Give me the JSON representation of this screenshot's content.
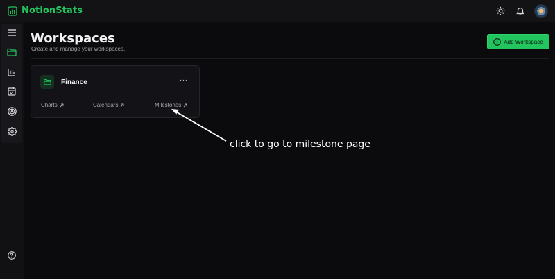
{
  "app": {
    "name": "NotionStats",
    "accent": "#22c55e"
  },
  "topbar": {
    "icons": [
      "theme-toggle-icon",
      "bell-icon"
    ]
  },
  "sidebar": {
    "items": [
      {
        "icon": "menu-icon"
      },
      {
        "icon": "folder-icon",
        "active": true
      },
      {
        "icon": "bar-chart-icon"
      },
      {
        "icon": "calendar-icon"
      },
      {
        "icon": "target-icon"
      },
      {
        "icon": "gear-icon"
      }
    ],
    "help_icon": "help-icon"
  },
  "page": {
    "title": "Workspaces",
    "subtitle": "Create and manage your workspaces.",
    "add_button_label": "Add Workspace"
  },
  "workspaces": [
    {
      "name": "Finance",
      "more": "···",
      "links": [
        "Charts",
        "Calendars",
        "Milestones"
      ]
    }
  ],
  "annotation": {
    "text": "click to go to milestone page"
  }
}
